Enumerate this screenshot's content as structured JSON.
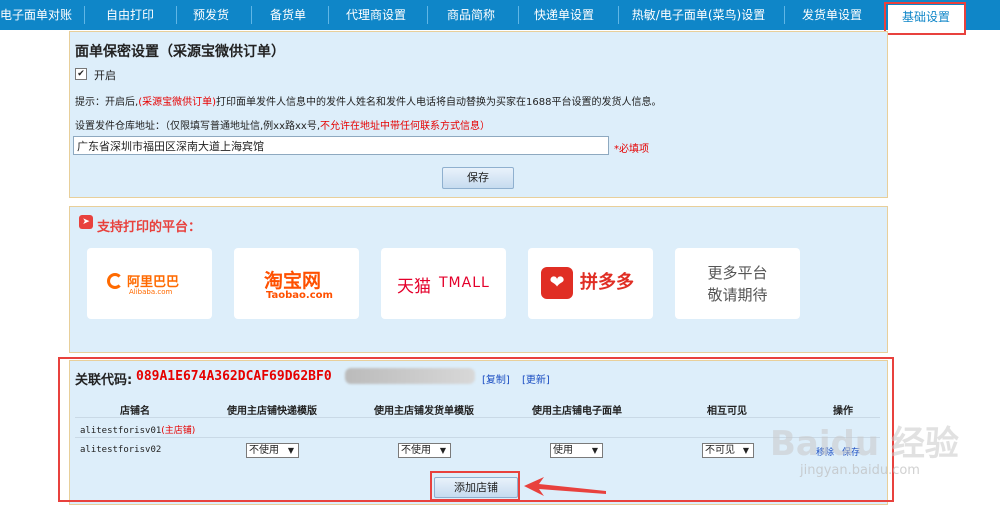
{
  "nav": {
    "tabs": [
      "电子面单对账",
      "自由打印",
      "预发货",
      "备货单",
      "代理商设置",
      "商品简称",
      "快递单设置",
      "热敏/电子面单(菜鸟)设置",
      "发货单设置",
      "基础设置"
    ],
    "active": "基础设置"
  },
  "privacy": {
    "title": "面单保密设置（采源宝微供订单）",
    "enable_label": "开启",
    "tip_prefix": "提示：开启后,",
    "tip_highlight": "(采源宝微供订单)",
    "tip_suffix": "打印面单发件人信息中的发件人姓名和发件人电话将自动替换为买家在1688平台设置的发货人信息。",
    "address_label": "设置发件仓库地址：（仅限填写普通地址信,例xx路xx号,",
    "address_warning": "不允许在地址中带任何联系方式信息）",
    "address_value": "广东省深圳市福田区深南大道上海宾馆",
    "required_note": "*必填项",
    "save_label": "保存"
  },
  "platforms": {
    "title": "支持打印的平台：",
    "items": [
      {
        "name": "阿里巴巴",
        "sub": "Alibaba.com"
      },
      {
        "name": "淘宝网",
        "sub": "Taobao.com"
      },
      {
        "name": "天猫",
        "sub": "TMALL"
      },
      {
        "name": "拼多多",
        "sub": ""
      },
      {
        "name": "更多平台",
        "sub": "敬请期待"
      }
    ]
  },
  "shops": {
    "code_label": "关联代码:",
    "code_value": "089A1E674A362DCAF69D62BF0",
    "copy_label": "[复制]",
    "refresh_label": "[更新]",
    "headers": [
      "店铺名",
      "使用主店铺快递模版",
      "使用主店铺发货单模版",
      "使用主店铺电子面单",
      "相互可见",
      "操作"
    ],
    "rows": [
      {
        "name": "alitestforisv01",
        "tag": "(主店铺)"
      },
      {
        "name": "alitestforisv02",
        "express": "不使用",
        "invoice": "不使用",
        "waybill": "使用",
        "visible": "不可见",
        "op1": "移除",
        "op2": "保存"
      }
    ],
    "add_label": "添加店铺"
  },
  "watermark": {
    "brand": "Baidu 经验",
    "url": "jingyan.baidu.com"
  },
  "colors": {
    "nav": "#0f86c8",
    "panel": "#ddeefa",
    "highlight_red": "#e60000",
    "annotation_red": "#e8413d"
  }
}
